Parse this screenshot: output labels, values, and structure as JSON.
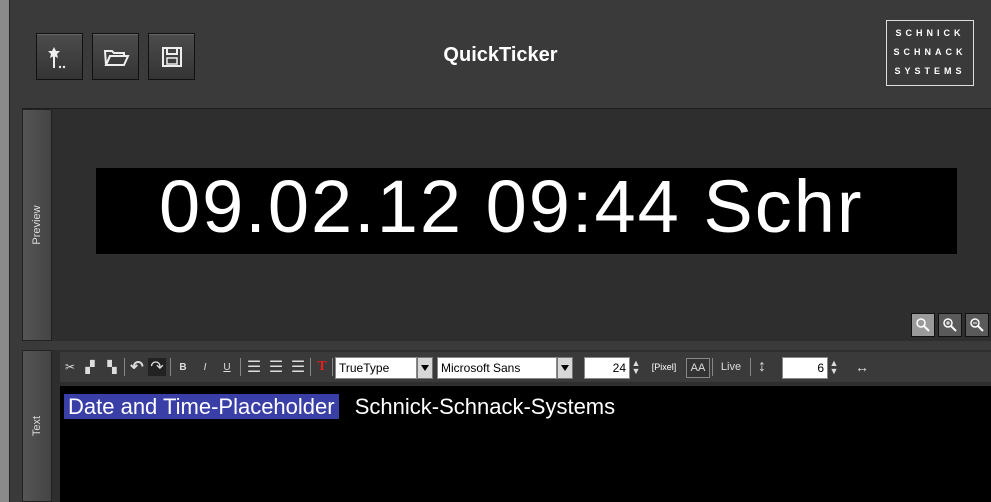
{
  "app": {
    "title": "QuickTicker"
  },
  "logo": {
    "lines": [
      "SCHNICK",
      "SCHNACK",
      "SYSTEMS"
    ]
  },
  "toolbar_top": {
    "buttons": [
      {
        "name": "new-button",
        "icon": "new-wand-icon"
      },
      {
        "name": "open-button",
        "icon": "folder-open-icon"
      },
      {
        "name": "save-button",
        "icon": "floppy-disk-icon"
      }
    ]
  },
  "preview": {
    "tab_label": "Preview",
    "display_text": "09.02.12 09:44   Schr",
    "zoom_controls": [
      "zoom-fit-icon",
      "zoom-in-icon",
      "zoom-out-icon"
    ]
  },
  "text_panel": {
    "tab_label": "Text",
    "toolbar": {
      "bold": "B",
      "italic": "I",
      "underline": "U",
      "color_label": "T",
      "font_type": "TrueType",
      "font_name": "Microsoft Sans",
      "font_size": "24",
      "unit_label": "[Pixel]",
      "aa_label": "AA",
      "live_label": "Live",
      "spacing_value": "6"
    },
    "editor": {
      "placeholder_text": "Date and Time-Placeholder",
      "content_text": "Schnick-Schnack-Systems"
    }
  }
}
